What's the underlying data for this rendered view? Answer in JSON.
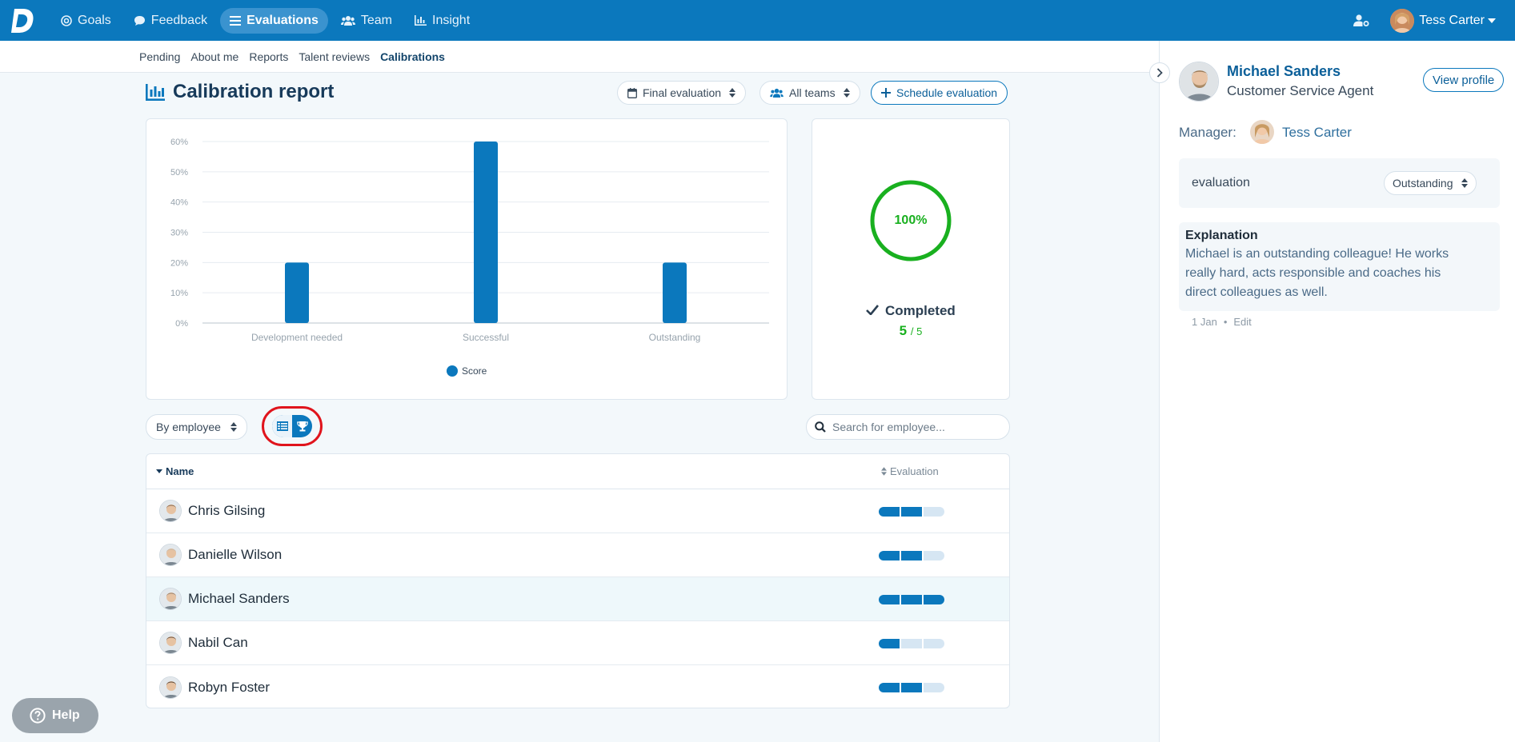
{
  "nav": {
    "items": [
      {
        "label": "Goals",
        "icon": "target-icon"
      },
      {
        "label": "Feedback",
        "icon": "chat-bubble-icon"
      },
      {
        "label": "Evaluations",
        "icon": "list-icon",
        "active": true
      },
      {
        "label": "Team",
        "icon": "team-icon"
      },
      {
        "label": "Insight",
        "icon": "bar-chart-icon"
      }
    ],
    "user_name": "Tess Carter"
  },
  "subnav": {
    "items": [
      "Pending",
      "About me",
      "Reports",
      "Talent reviews",
      "Calibrations"
    ],
    "active": "Calibrations"
  },
  "page": {
    "title": "Calibration report",
    "filter_evaluation": "Final evaluation",
    "filter_teams": "All teams",
    "schedule_label": "Schedule evaluation"
  },
  "chart_data": {
    "type": "bar",
    "categories": [
      "Development needed",
      "Successful",
      "Outstanding"
    ],
    "series": [
      {
        "name": "Score",
        "values": [
          20,
          60,
          20
        ]
      }
    ],
    "ylim": [
      0,
      60
    ],
    "yticks": [
      "0%",
      "10%",
      "20%",
      "30%",
      "40%",
      "50%",
      "60%"
    ],
    "grid": true,
    "legend": "bottom",
    "color": "#0b78bd"
  },
  "completion": {
    "percent_label": "100%",
    "percent": 100,
    "status": "Completed",
    "done": "5",
    "total": "/ 5"
  },
  "controls": {
    "group_by": "By employee",
    "search_placeholder": "Search for employee..."
  },
  "table": {
    "col_name": "Name",
    "col_eval": "Evaluation",
    "rows": [
      {
        "name": "Chris Gilsing",
        "level": 2
      },
      {
        "name": "Danielle Wilson",
        "level": 2
      },
      {
        "name": "Michael Sanders",
        "level": 3,
        "selected": true
      },
      {
        "name": "Nabil Can",
        "level": 1
      },
      {
        "name": "Robyn Foster",
        "level": 2
      }
    ]
  },
  "help_label": "Help",
  "panel": {
    "name": "Michael Sanders",
    "role": "Customer Service Agent",
    "view_profile": "View profile",
    "manager_label": "Manager:",
    "manager_name": "Tess Carter",
    "eval_label": "evaluation",
    "eval_value": "Outstanding",
    "explanation_title": "Explanation",
    "explanation_text": "Michael is an outstanding colleague! He works really hard, acts responsible and coaches his direct colleagues as well.",
    "date": "1 Jan",
    "edit_label": "Edit"
  }
}
